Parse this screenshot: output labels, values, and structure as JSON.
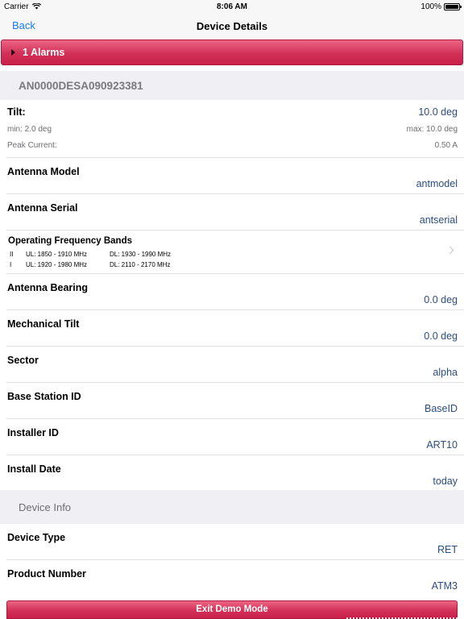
{
  "status_bar": {
    "carrier": "Carrier",
    "time": "8:06 AM",
    "battery": "100%",
    "battery_level": 1.0
  },
  "nav": {
    "back_label": "Back",
    "title": "Device Details"
  },
  "alarm": {
    "label": "1 Alarms"
  },
  "device": {
    "serial": "AN0000DESA090923381"
  },
  "tilt": {
    "label": "Tilt:",
    "value": "10.0 deg",
    "min": "min: 2.0 deg",
    "max": "max: 10.0 deg",
    "peak_label": "Peak Current:",
    "peak_value": "0.50 A"
  },
  "rows_a": [
    {
      "label": "Antenna Model",
      "value": "antmodel"
    },
    {
      "label": "Antenna Serial",
      "value": "antserial"
    }
  ],
  "frequency": {
    "title": "Operating Frequency Bands",
    "bands": [
      {
        "num": "II",
        "ul": "UL: 1850 - 1910 MHz",
        "dl": "DL: 1930 - 1990 MHz"
      },
      {
        "num": "I",
        "ul": "UL: 1920 - 1980 MHz",
        "dl": "DL: 2110 - 2170 MHz"
      }
    ]
  },
  "rows_b": [
    {
      "label": "Antenna Bearing",
      "value": "0.0 deg"
    },
    {
      "label": "Mechanical Tilt",
      "value": "0.0 deg"
    },
    {
      "label": "Sector",
      "value": "alpha"
    },
    {
      "label": "Base Station ID",
      "value": "BaseID"
    },
    {
      "label": "Installer ID",
      "value": "ART10"
    },
    {
      "label": "Install Date",
      "value": "today"
    }
  ],
  "device_info": {
    "header": "Device Info",
    "rows": [
      {
        "label": "Device Type",
        "value": "RET"
      },
      {
        "label": "Product Number",
        "value": "ATM3"
      }
    ]
  },
  "exit": {
    "label": "Exit Demo Mode"
  },
  "colors": {
    "accent": "#1a7cf0",
    "alarm": "#d23057",
    "value_text": "#2c4d80"
  }
}
